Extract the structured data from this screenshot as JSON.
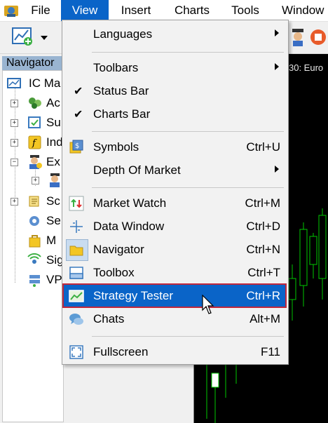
{
  "menubar": {
    "items": [
      {
        "label": "File"
      },
      {
        "label": "View"
      },
      {
        "label": "Insert"
      },
      {
        "label": "Charts"
      },
      {
        "label": "Tools"
      },
      {
        "label": "Window"
      }
    ]
  },
  "navigator": {
    "title": "Navigator",
    "items": [
      {
        "label": "IC Ma",
        "icon": "terminal-icon"
      },
      {
        "label": "Ac",
        "icon": "accounts-icon"
      },
      {
        "label": "Su",
        "icon": "subscriptions-icon"
      },
      {
        "label": "Ind",
        "icon": "indicators-icon"
      },
      {
        "label": "Ex",
        "icon": "expert-advisors-icon"
      },
      {
        "label": "",
        "icon": "expert-icon"
      },
      {
        "label": "Sc",
        "icon": "scripts-icon"
      },
      {
        "label": "Se",
        "icon": "services-icon"
      },
      {
        "label": "M",
        "icon": "market-icon"
      },
      {
        "label": "Sig",
        "icon": "signals-icon"
      },
      {
        "label": "VP",
        "icon": "vps-icon"
      }
    ]
  },
  "chart": {
    "title": "30: Euro"
  },
  "view_menu": {
    "items": [
      {
        "label": "Languages",
        "shortcut": "",
        "submenu": true
      },
      {
        "label": "Toolbars",
        "shortcut": "",
        "submenu": true
      },
      {
        "label": "Status Bar",
        "shortcut": "",
        "checked": true
      },
      {
        "label": "Charts Bar",
        "shortcut": "",
        "checked": true
      },
      {
        "label": "Symbols",
        "shortcut": "Ctrl+U",
        "icon": "symbols-icon"
      },
      {
        "label": "Depth Of Market",
        "shortcut": "",
        "submenu": true
      },
      {
        "label": "Market Watch",
        "shortcut": "Ctrl+M",
        "icon": "market-watch-icon"
      },
      {
        "label": "Data Window",
        "shortcut": "Ctrl+D",
        "icon": "data-window-icon"
      },
      {
        "label": "Navigator",
        "shortcut": "Ctrl+N",
        "icon": "navigator-icon"
      },
      {
        "label": "Toolbox",
        "shortcut": "Ctrl+T",
        "icon": "toolbox-icon"
      },
      {
        "label": "Strategy Tester",
        "shortcut": "Ctrl+R",
        "icon": "strategy-tester-icon",
        "highlighted": true
      },
      {
        "label": "Chats",
        "shortcut": "Alt+M",
        "icon": "chats-icon"
      },
      {
        "label": "Fullscreen",
        "shortcut": "F11",
        "icon": "fullscreen-icon"
      }
    ]
  },
  "colors": {
    "menu_highlight": "#0a64c8",
    "highlight_outline": "#c0283c",
    "candle_green": "#00c800",
    "chart_bg": "#000000"
  }
}
